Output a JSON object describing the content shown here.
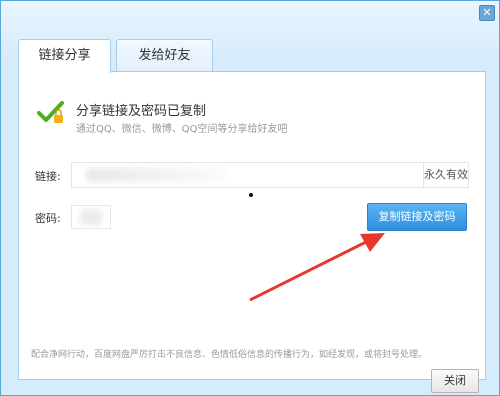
{
  "window": {
    "close_glyph": "✕"
  },
  "tabs": [
    {
      "label": "链接分享",
      "active": true
    },
    {
      "label": "发给好友",
      "active": false
    }
  ],
  "success": {
    "title": "分享链接及密码已复制",
    "subtitle": "通过QQ、微信、微博、QQ空间等分享给好友吧",
    "icon": "check-icon"
  },
  "link": {
    "label": "链接:",
    "validity": "永久有效"
  },
  "code": {
    "label": "密码:"
  },
  "copy_button": {
    "label": "复制链接及密码"
  },
  "notice": "配合净网行动，百度网盘严厉打击不良信息、色情低俗信息的传播行为，如经发现，或将封号处理。",
  "close_button": {
    "label": "关闭"
  },
  "colors": {
    "accent": "#2e8fe0",
    "check": "#4caf1e",
    "arrow": "#e8382e"
  }
}
